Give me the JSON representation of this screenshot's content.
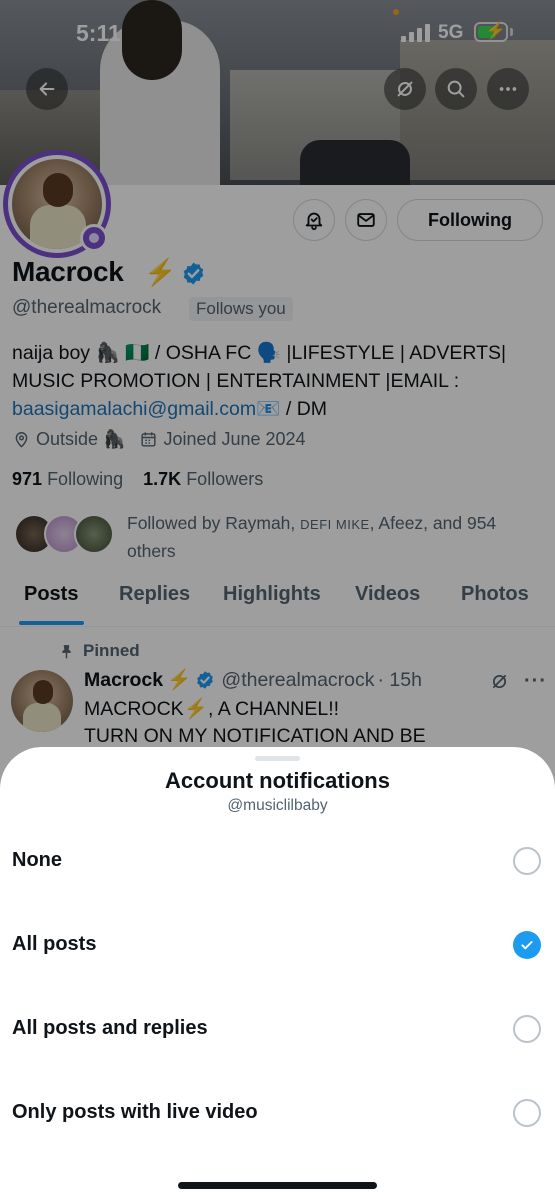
{
  "status_bar": {
    "time": "5:11",
    "network": "5G"
  },
  "profile": {
    "name": "Macrock",
    "name_emoji": "⚡",
    "handle": "@therealmacrock",
    "follows_you": "Follows you",
    "follow_button": "Following",
    "bio_line1": "naija boy 🦍 🇳🇬 / OSHA FC 🗣️ |LIFESTYLE | ADVERTS|",
    "bio_line2": "MUSIC PROMOTION | ENTERTAINMENT |EMAIL :",
    "bio_email": "baasigamalachi@gmail.com",
    "bio_line3_suffix": "📧 / DM",
    "location": "Outside 🦍",
    "joined": "Joined June 2024",
    "following_count": "971",
    "following_label": "Following",
    "followers_count": "1.7K",
    "followers_label": "Followers",
    "followed_by_prefix": "Followed by Raymah,",
    "followed_by_smallcaps": "DEFI MIKE",
    "followed_by_suffix": ", Afeez, and 954",
    "followed_by_line2": "others"
  },
  "tabs": [
    "Posts",
    "Replies",
    "Highlights",
    "Videos",
    "Photos"
  ],
  "pinned_post": {
    "pinned_label": "Pinned",
    "author": "Macrock",
    "emoji": "⚡",
    "handle": "@therealmacrock",
    "time": "· 15h",
    "line1": "MACROCK⚡, A CHANNEL!!",
    "line2": "TURN ON MY NOTIFICATION AND BE"
  },
  "sheet": {
    "title": "Account notifications",
    "subtitle": "@musiclilbaby",
    "options": [
      {
        "label": "None",
        "selected": false
      },
      {
        "label": "All posts",
        "selected": true
      },
      {
        "label": "All posts and replies",
        "selected": false
      },
      {
        "label": "Only posts with live video",
        "selected": false
      }
    ]
  },
  "colors": {
    "accent": "#1d9bf0",
    "avatar_ring": "#7b4fd1",
    "verified": "#1d9bf0",
    "muted_text": "#536471"
  }
}
